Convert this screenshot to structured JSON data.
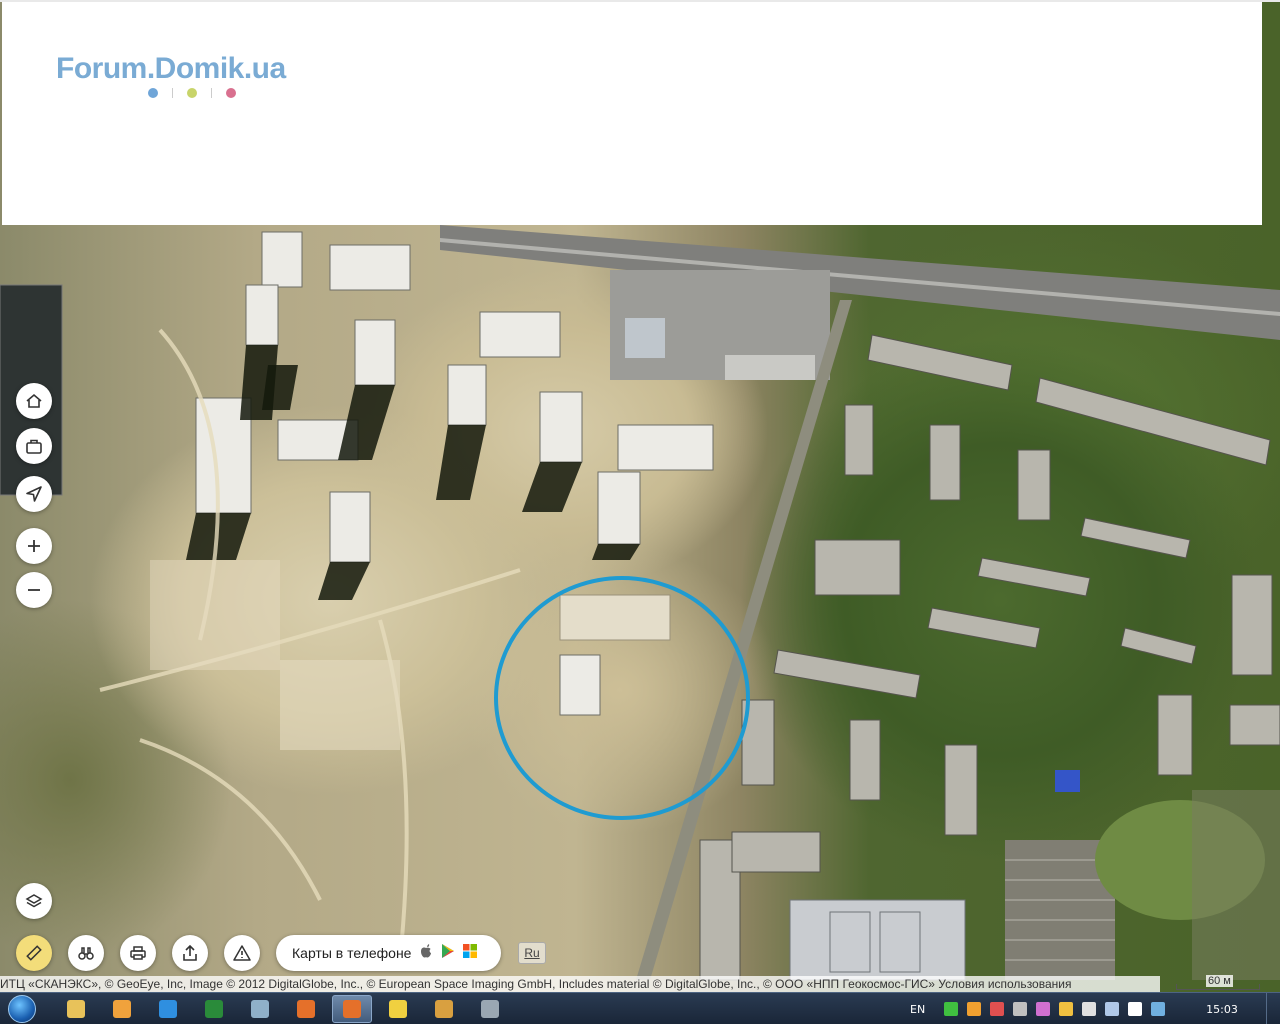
{
  "header": {
    "logo_text": "Forum.Domik.ua",
    "logo_dot_colors": [
      "#6fa5d8",
      "#c8d46a",
      "#d9708f"
    ]
  },
  "map": {
    "highlight_color": "#1f9bd1",
    "controls": {
      "left": [
        {
          "name": "home-icon",
          "glyph": "⌂"
        },
        {
          "name": "briefcase-icon",
          "glyph": "▣"
        },
        {
          "name": "locate-arrow-icon",
          "glyph": "➤"
        },
        {
          "name": "zoom-in-icon",
          "glyph": "+"
        },
        {
          "name": "zoom-out-icon",
          "glyph": "−"
        },
        {
          "name": "layers-icon",
          "glyph": "◈"
        }
      ],
      "bottom": [
        {
          "name": "ruler-icon",
          "glyph": "📏"
        },
        {
          "name": "binoculars-icon",
          "glyph": "⌕"
        },
        {
          "name": "print-icon",
          "glyph": "⎙"
        },
        {
          "name": "share-icon",
          "glyph": "⇪"
        },
        {
          "name": "warning-icon",
          "glyph": "⚠"
        }
      ]
    },
    "phone_pill": {
      "label": "Карты в телефоне",
      "apple_glyph": "",
      "play_glyph": "▶",
      "windows_glyph": "⊞"
    },
    "lang_button": "Ru",
    "attribution": "ИТЦ «СКАНЭКС», © GeoEye, Inc, Image © 2012 DigitalGlobe, Inc., © European Space Imaging GmbH, Includes material © DigitalGlobe, Inc., © ООО «НПП Геокосмос-ГИС»",
    "terms_link": "Условия использования",
    "scale_label": "60 м"
  },
  "taskbar": {
    "buttons": [
      {
        "name": "explorer-icon",
        "color": "#e8c25a",
        "active": false
      },
      {
        "name": "media-player-icon",
        "color": "#f0a23c",
        "active": false
      },
      {
        "name": "internet-explorer-icon",
        "color": "#2f8fe0",
        "active": false
      },
      {
        "name": "excel-icon",
        "color": "#2a8b3a",
        "active": false
      },
      {
        "name": "remote-desktop-icon",
        "color": "#8fb0c9",
        "active": false
      },
      {
        "name": "firefox-icon",
        "color": "#e5702a",
        "active": false
      },
      {
        "name": "firefox-window-icon",
        "color": "#e5702a",
        "active": true
      },
      {
        "name": "paint-icon",
        "color": "#f0d040",
        "active": false
      },
      {
        "name": "notepad-icon",
        "color": "#d9a040",
        "active": false
      },
      {
        "name": "utility-icon",
        "color": "#9aa7b3",
        "active": false
      }
    ],
    "lang_indicator": "EN",
    "tray_colors": [
      "#40c040",
      "#f0a030",
      "#e05050",
      "#c0c0c0",
      "#d070d0",
      "#f0c040",
      "#e0e0e0",
      "#b0c8e8",
      "#ffffff",
      "#70b0e0"
    ],
    "clock": "15:03"
  }
}
